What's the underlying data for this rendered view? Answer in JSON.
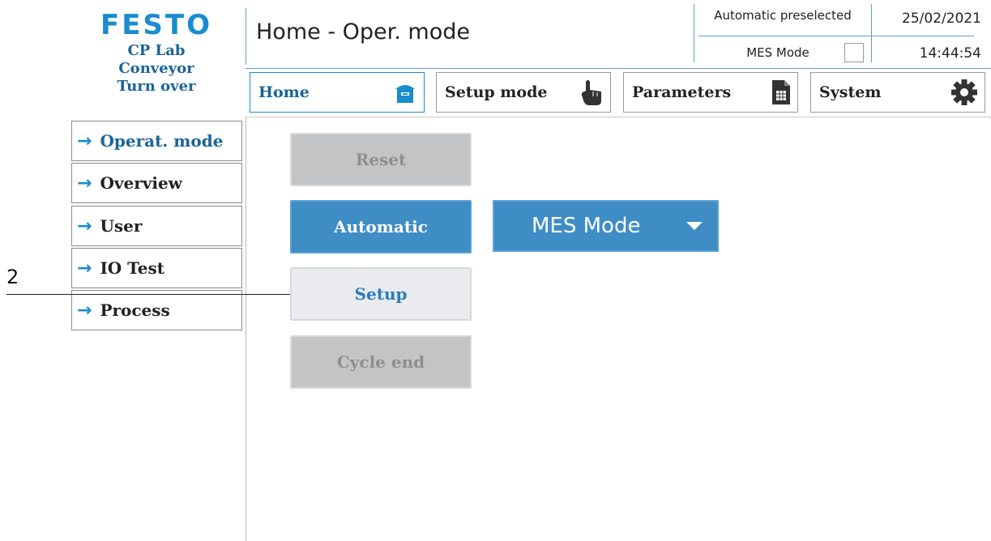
{
  "brand": {
    "logo_text": "FESTO",
    "line1": "CP Lab",
    "line2": "Conveyor",
    "line3": "Turn over"
  },
  "header": {
    "title": "Home - Oper. mode",
    "status": "Automatic preselected",
    "mes_mode_label": "MES Mode",
    "mes_mode_checked": false,
    "date": "25/02/2021",
    "time": "14:44:54"
  },
  "nav": [
    {
      "label": "Home",
      "icon": "home-icon",
      "active": true
    },
    {
      "label": "Setup mode",
      "icon": "hand-pointer-icon",
      "active": false
    },
    {
      "label": "Parameters",
      "icon": "document-icon",
      "active": false
    },
    {
      "label": "System",
      "icon": "gear-icon",
      "active": false
    }
  ],
  "side_menu": [
    {
      "label": "Operat. mode",
      "active": true
    },
    {
      "label": "Overview",
      "active": false
    },
    {
      "label": "User",
      "active": false
    },
    {
      "label": "IO Test",
      "active": false
    },
    {
      "label": "Process",
      "active": false
    }
  ],
  "actions": {
    "reset": "Reset",
    "automatic": "Automatic",
    "setup": "Setup",
    "cycle_end": "Cycle end"
  },
  "mode_select": {
    "selected": "MES Mode"
  },
  "callout": {
    "number": "2"
  },
  "colors": {
    "accent": "#1a8ccf",
    "button_blue": "#3f8dc5",
    "disabled_gray": "#c3c4c6"
  }
}
